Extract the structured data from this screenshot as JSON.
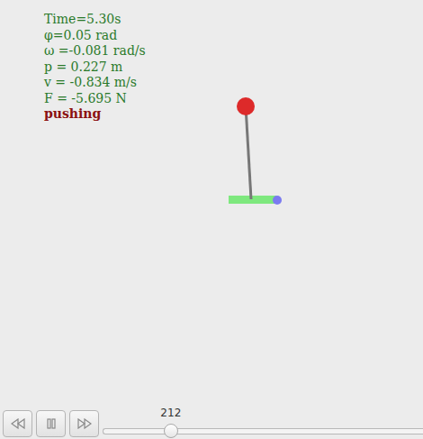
{
  "readouts": [
    "Time=5.30s",
    "φ=0.05 rad",
    "ω =-0.081 rad/s",
    "p = 0.227 m",
    "v = -0.834 m/s",
    "F = -5.695 N"
  ],
  "status": "pushing",
  "playback": {
    "frame": "212",
    "level": 0.213
  }
}
